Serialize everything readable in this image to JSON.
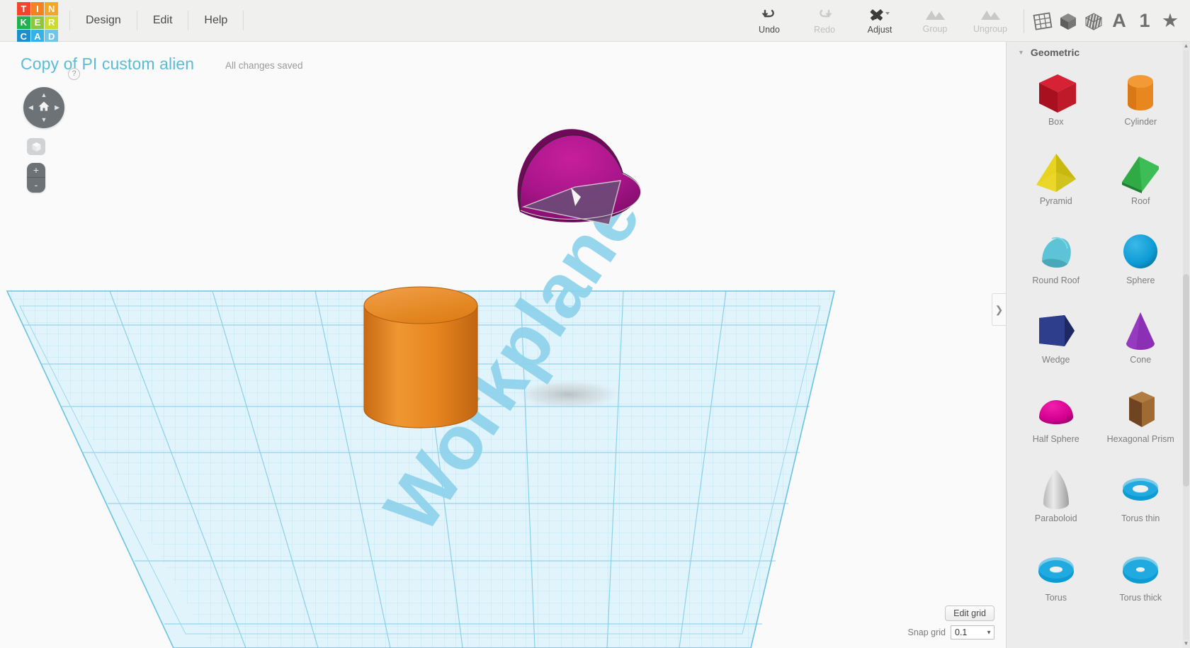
{
  "app": {
    "logo_tiles": [
      {
        "letter": "T",
        "color": "#f8432c"
      },
      {
        "letter": "I",
        "color": "#f58220"
      },
      {
        "letter": "N",
        "color": "#f5a623"
      },
      {
        "letter": "K",
        "color": "#22b14c"
      },
      {
        "letter": "E",
        "color": "#8cc63f"
      },
      {
        "letter": "R",
        "color": "#cddc2a"
      },
      {
        "letter": "C",
        "color": "#1f8ecd"
      },
      {
        "letter": "A",
        "color": "#35b0e8"
      },
      {
        "letter": "D",
        "color": "#74c4ea"
      }
    ],
    "accent_color": "#5bbcd6"
  },
  "menu": [
    {
      "label": "Design"
    },
    {
      "label": "Edit"
    },
    {
      "label": "Help"
    }
  ],
  "toolbar": {
    "undo": {
      "label": "Undo",
      "icon": "undo-arrow-icon",
      "enabled": true
    },
    "redo": {
      "label": "Redo",
      "icon": "redo-arrow-icon",
      "enabled": false
    },
    "adjust": {
      "label": "Adjust",
      "icon": "adjust-ruler-pencil-icon",
      "enabled": true
    },
    "group": {
      "label": "Group",
      "icon": "group-mountains-icon",
      "enabled": false
    },
    "ungroup": {
      "label": "Ungroup",
      "icon": "ungroup-mountains-icon",
      "enabled": false
    },
    "icons": [
      {
        "name": "workplane-grid-icon"
      },
      {
        "name": "solid-cube-icon"
      },
      {
        "name": "striped-cube-icon"
      },
      {
        "name": "text-a-icon",
        "glyph": "A"
      },
      {
        "name": "number-one-icon",
        "glyph": "1"
      },
      {
        "name": "star-favorite-icon",
        "glyph": "★"
      }
    ]
  },
  "document": {
    "title": "Copy of PI custom alien",
    "save_status": "All changes saved"
  },
  "viewcube": {
    "help_label": "?",
    "home_icon": "home-icon",
    "arrow_up": "▲",
    "arrow_down": "▼",
    "arrow_left": "◀",
    "arrow_right": "▶",
    "fit_view_icon": "fit-to-view-cube-icon",
    "zoom_in": "+",
    "zoom_out": "-"
  },
  "workplane": {
    "label": "Workplane",
    "grid_color": "#8fd6ee",
    "plane_fill": "#d9f1fa"
  },
  "scene": {
    "objects": [
      {
        "name": "cylinder",
        "color": "#e8861f",
        "selected": false
      },
      {
        "name": "half-sphere",
        "color": "#b5188a",
        "selected": true
      }
    ]
  },
  "grid_controls": {
    "edit_grid_label": "Edit grid",
    "snap_grid_label": "Snap grid",
    "snap_grid_value": "0.1",
    "caret": "▼"
  },
  "panel": {
    "collapse_handle": "❯",
    "section_title": "Geometric",
    "section_caret": "▼",
    "shapes": [
      {
        "label": "Box",
        "icon": "box-shape-icon",
        "color": "#c0192c"
      },
      {
        "label": "Cylinder",
        "icon": "cylinder-shape-icon",
        "color": "#e8861f"
      },
      {
        "label": "Pyramid",
        "icon": "pyramid-shape-icon",
        "color": "#e8d41f"
      },
      {
        "label": "Roof",
        "icon": "roof-shape-icon",
        "color": "#2faa45"
      },
      {
        "label": "Round Roof",
        "icon": "round-roof-shape-icon",
        "color": "#5cc4d6"
      },
      {
        "label": "Sphere",
        "icon": "sphere-shape-icon",
        "color": "#0d9bd4"
      },
      {
        "label": "Wedge",
        "icon": "wedge-shape-icon",
        "color": "#27347a"
      },
      {
        "label": "Cone",
        "icon": "cone-shape-icon",
        "color": "#8b2fb5"
      },
      {
        "label": "Half Sphere",
        "icon": "half-sphere-shape-icon",
        "color": "#d4008f"
      },
      {
        "label": "Hexagonal Prism",
        "icon": "hexagonal-prism-shape-icon",
        "color": "#8a5a2b"
      },
      {
        "label": "Paraboloid",
        "icon": "paraboloid-shape-icon",
        "color": "#c9c9c9"
      },
      {
        "label": "Torus thin",
        "icon": "torus-thin-shape-icon",
        "color": "#0d9bd4"
      },
      {
        "label": "Torus",
        "icon": "torus-shape-icon",
        "color": "#0d9bd4"
      },
      {
        "label": "Torus thick",
        "icon": "torus-thick-shape-icon",
        "color": "#0d9bd4"
      }
    ]
  }
}
